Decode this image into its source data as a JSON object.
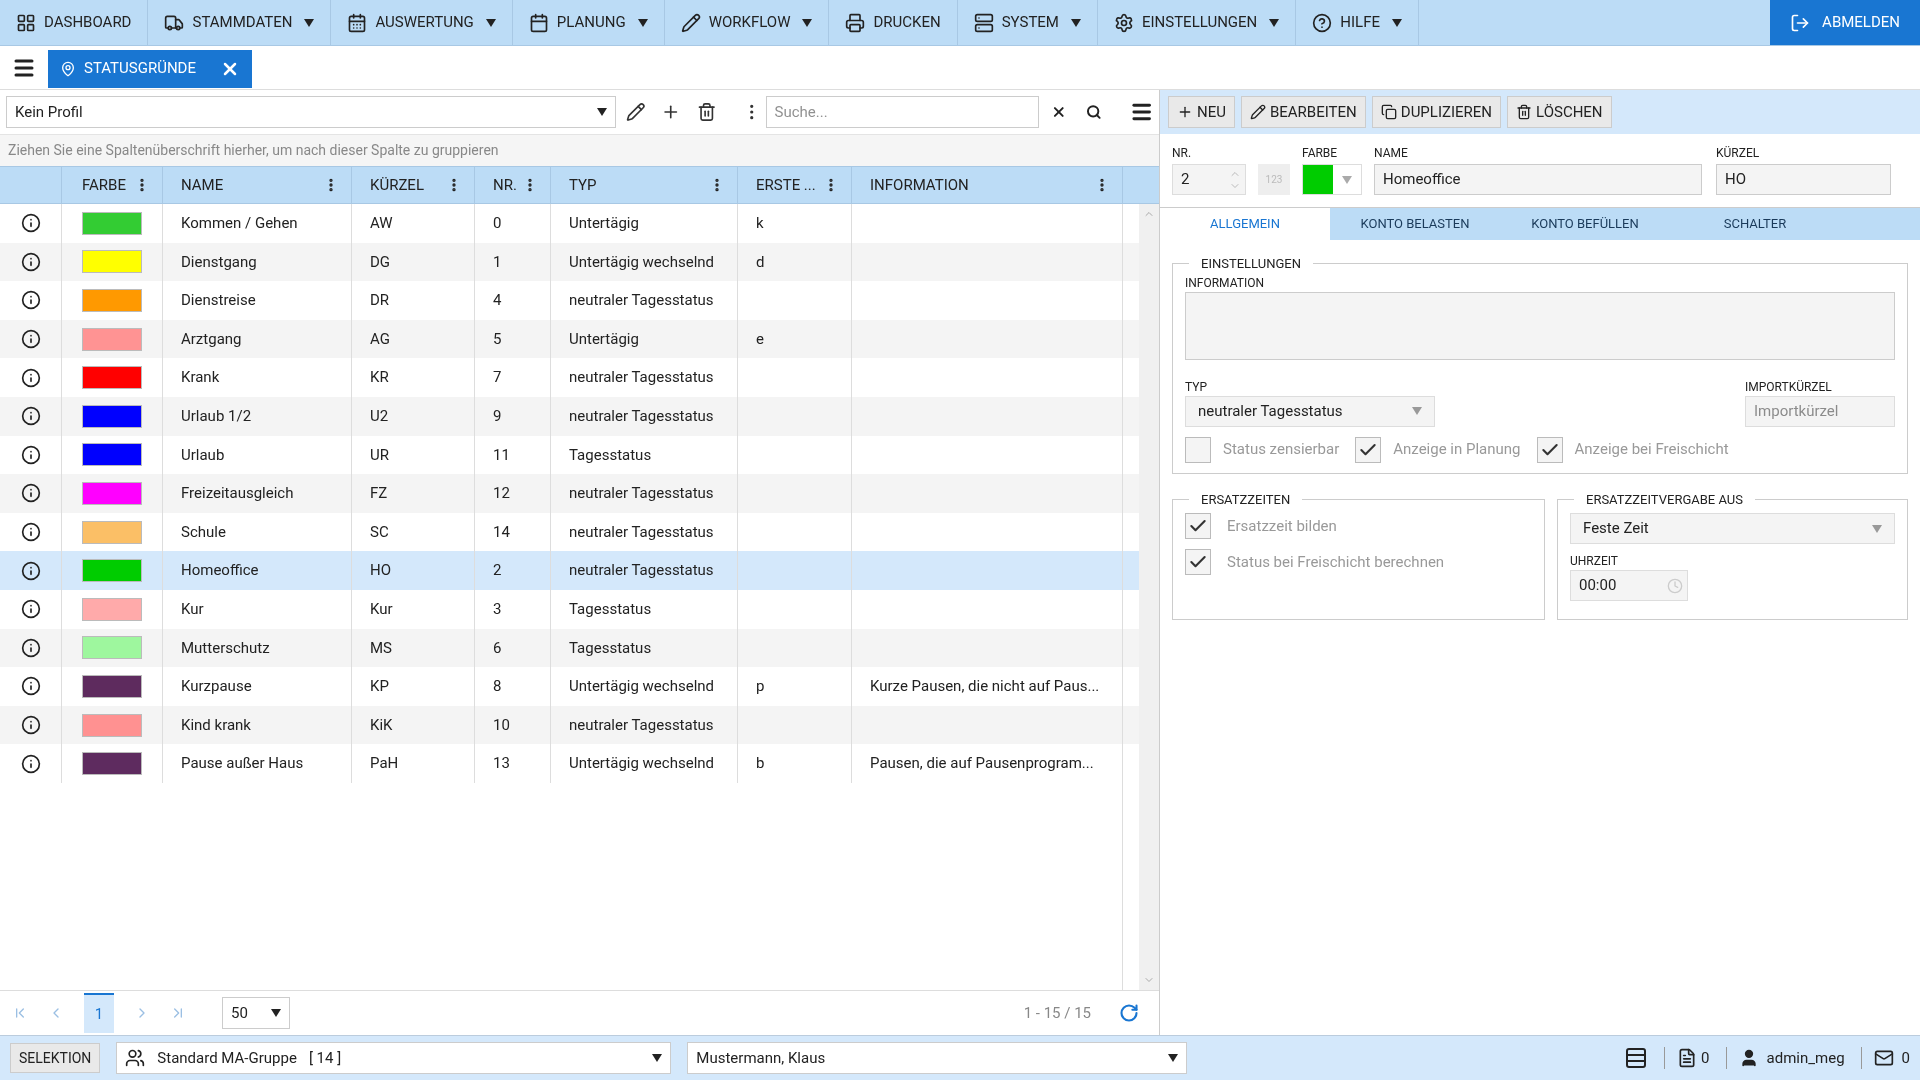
{
  "nav": {
    "items": [
      {
        "label": "DASHBOARD",
        "dropdown": false
      },
      {
        "label": "STAMMDATEN",
        "dropdown": true
      },
      {
        "label": "AUSWERTUNG",
        "dropdown": true
      },
      {
        "label": "PLANUNG",
        "dropdown": true
      },
      {
        "label": "WORKFLOW",
        "dropdown": true
      },
      {
        "label": "DRUCKEN",
        "dropdown": false
      },
      {
        "label": "SYSTEM",
        "dropdown": true
      },
      {
        "label": "EINSTELLUNGEN",
        "dropdown": true
      },
      {
        "label": "HILFE",
        "dropdown": true
      }
    ],
    "logout": "ABMELDEN"
  },
  "open_tab": {
    "label": "STATUSGRÜNDE"
  },
  "list": {
    "profile": "Kein Profil",
    "search": {
      "placeholder": "Suche..."
    },
    "group_hint": "Ziehen Sie eine Spaltenüberschrift hierher, um nach dieser Spalte zu gruppieren",
    "columns": [
      "FARBE",
      "NAME",
      "KÜRZEL",
      "NR.",
      "TYP",
      "ERSTE ...",
      "INFORMATION"
    ],
    "rows": [
      {
        "color": "#33cc33",
        "name": "Kommen / Gehen",
        "short": "AW",
        "nr": "0",
        "type": "Untertägig",
        "first": "k",
        "info": "",
        "selected": false
      },
      {
        "color": "#ffff00",
        "name": "Dienstgang",
        "short": "DG",
        "nr": "1",
        "type": "Untertägig wechselnd",
        "first": "d",
        "info": "",
        "selected": false
      },
      {
        "color": "#ff9900",
        "name": "Dienstreise",
        "short": "DR",
        "nr": "4",
        "type": "neutraler Tagesstatus",
        "first": "",
        "info": "",
        "selected": false
      },
      {
        "color": "#ff9393",
        "name": "Arztgang",
        "short": "AG",
        "nr": "5",
        "type": "Untertägig",
        "first": "e",
        "info": "",
        "selected": false
      },
      {
        "color": "#ff0000",
        "name": "Krank",
        "short": "KR",
        "nr": "7",
        "type": "neutraler Tagesstatus",
        "first": "",
        "info": "",
        "selected": false
      },
      {
        "color": "#0000ff",
        "name": "Urlaub 1/2",
        "short": "U2",
        "nr": "9",
        "type": "neutraler Tagesstatus",
        "first": "",
        "info": "",
        "selected": false
      },
      {
        "color": "#0000fe",
        "name": "Urlaub",
        "short": "UR",
        "nr": "11",
        "type": "Tagesstatus",
        "first": "",
        "info": "",
        "selected": false
      },
      {
        "color": "#ff00ff",
        "name": "Freizeitausgleich",
        "short": "FZ",
        "nr": "12",
        "type": "neutraler Tagesstatus",
        "first": "",
        "info": "",
        "selected": false
      },
      {
        "color": "#fbbf66",
        "name": "Schule",
        "short": "SC",
        "nr": "14",
        "type": "neutraler Tagesstatus",
        "first": "",
        "info": "",
        "selected": false
      },
      {
        "color": "#00cc00",
        "name": "Homeoffice",
        "short": "HO",
        "nr": "2",
        "type": "neutraler Tagesstatus",
        "first": "",
        "info": "",
        "selected": true
      },
      {
        "color": "#ffaaaa",
        "name": "Kur",
        "short": "Kur",
        "nr": "3",
        "type": "Tagesstatus",
        "first": "",
        "info": "",
        "selected": false
      },
      {
        "color": "#9ef79e",
        "name": "Mutterschutz",
        "short": "MS",
        "nr": "6",
        "type": "Tagesstatus",
        "first": "",
        "info": "",
        "selected": false
      },
      {
        "color": "#5e2b5e",
        "name": "Kurzpause",
        "short": "KP",
        "nr": "8",
        "type": "Untertägig wechselnd",
        "first": "p",
        "info": "Kurze Pausen, die nicht auf Paus...",
        "selected": false
      },
      {
        "color": "#ff9191",
        "name": "Kind krank",
        "short": "KiK",
        "nr": "10",
        "type": "neutraler Tagesstatus",
        "first": "",
        "info": "",
        "selected": false
      },
      {
        "color": "#5e2b5f",
        "name": "Pause außer Haus",
        "short": "PaH",
        "nr": "13",
        "type": "Untertägig wechselnd",
        "first": "b",
        "info": "Pausen, die auf Pausenprogram...",
        "selected": false
      }
    ],
    "pager": {
      "page": "1",
      "page_size": "50",
      "range": "1 - 15 / 15"
    }
  },
  "detail": {
    "toolbar": [
      "NEU",
      "BEARBEITEN",
      "DUPLIZIEREN",
      "LÖSCHEN"
    ],
    "nr_label": "NR.",
    "nr": "2",
    "nr_button": "123",
    "color_label": "FARBE",
    "color": "#00cc00",
    "name_label": "NAME",
    "name": "Homeoffice",
    "short_label": "KÜRZEL",
    "short": "HO",
    "tabs": [
      {
        "label": "ALLGEMEIN",
        "selected": true
      },
      {
        "label": "KONTO BELASTEN",
        "selected": false
      },
      {
        "label": "KONTO BEFÜLLEN",
        "selected": false
      },
      {
        "label": "SCHALTER",
        "selected": false
      }
    ],
    "settings": {
      "title": "EINSTELLUNGEN",
      "info_label": "INFORMATION",
      "type_label": "TYP",
      "type": "neutraler Tagesstatus",
      "import_label": "IMPORTKÜRZEL",
      "import_placeholder": "Importkürzel",
      "checks": [
        {
          "label": "Status zensierbar",
          "checked": false
        },
        {
          "label": "Anzeige in Planung",
          "checked": true
        },
        {
          "label": "Anzeige bei Freischicht",
          "checked": true
        }
      ]
    },
    "replacement": {
      "title": "ERSATZZEITEN",
      "checks": [
        {
          "label": "Ersatzzeit bilden",
          "checked": true
        },
        {
          "label": "Status bei Freischicht berechnen",
          "checked": true
        }
      ]
    },
    "assign": {
      "title": "ERSATZZEITVERGABE AUS",
      "mode": "Feste Zeit",
      "time_label": "UHRZEIT",
      "time": "00:00"
    }
  },
  "status_bar": {
    "selection": "SELEKTION",
    "group": "Standard MA-Gruppe",
    "group_count": "[ 14 ]",
    "person": "Mustermann, Klaus",
    "pdf_count": "0",
    "user": "admin_meg",
    "mail_count": "0"
  }
}
